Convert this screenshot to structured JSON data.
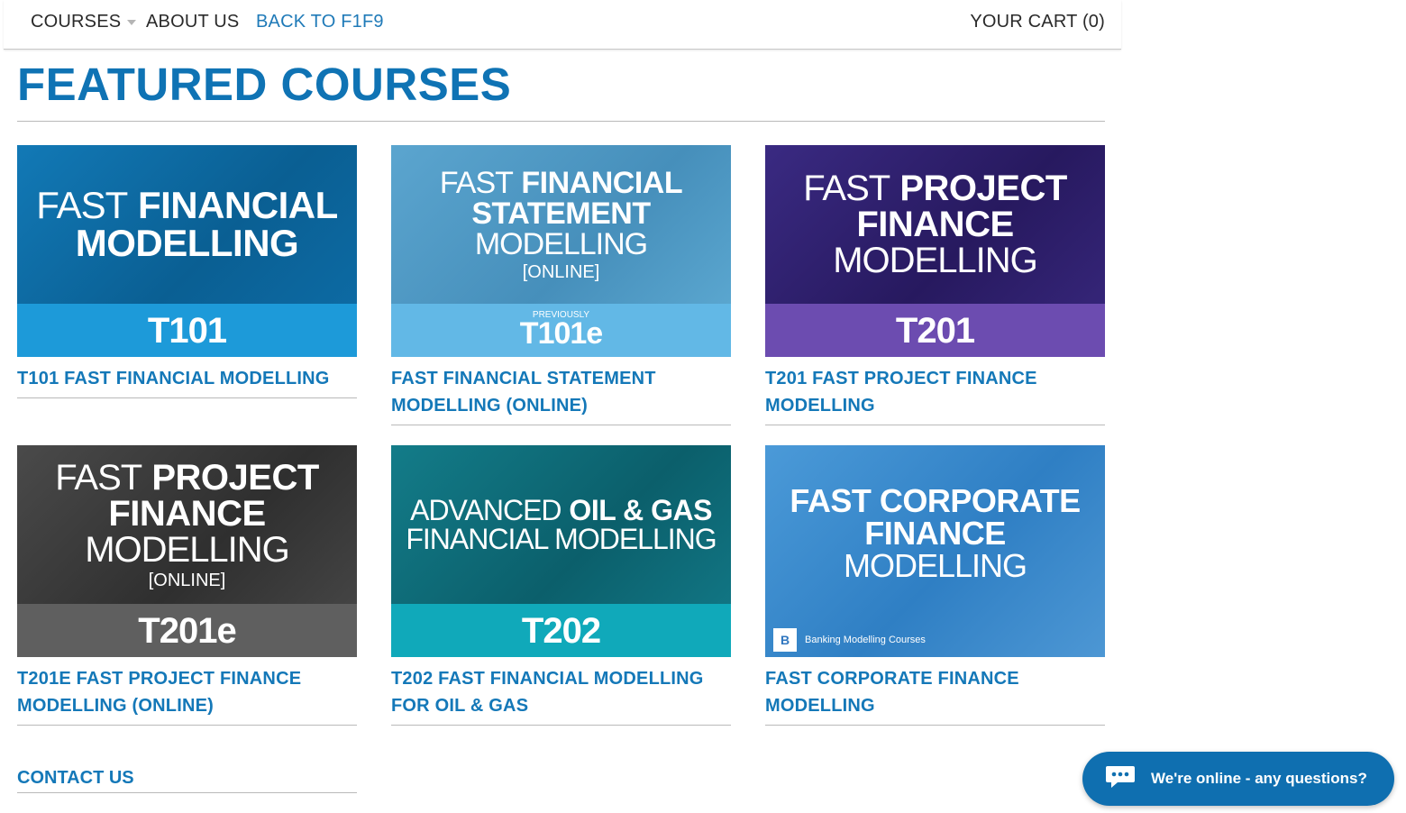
{
  "nav": {
    "courses": "COURSES",
    "about": "ABOUT US",
    "back": "BACK TO F1F9",
    "cart": "YOUR CART (0)"
  },
  "page": {
    "title": "FEATURED COURSES"
  },
  "courses": [
    {
      "image": {
        "line1_light": "FAST",
        "line1_bold": "FINANCIAL",
        "line2": "MODELLING",
        "code": "T101"
      },
      "title": "T101 FAST FINANCIAL MODELLING"
    },
    {
      "image": {
        "line1_light": "FAST",
        "line1_bold": "FINANCIAL",
        "line2": "STATEMENT",
        "line3": "MODELLING",
        "line4": "[ONLINE]",
        "previously": "PREVIOUSLY",
        "code": "T101e"
      },
      "title": "FAST FINANCIAL STATEMENT MODELLING (ONLINE)"
    },
    {
      "image": {
        "line1_light": "FAST",
        "line1_bold": "PROJECT",
        "line2": "FINANCE",
        "line3": "MODELLING",
        "code": "T201"
      },
      "title": "T201 FAST PROJECT FINANCE MODELLING"
    },
    {
      "image": {
        "line1_light": "FAST",
        "line1_bold": "PROJECT",
        "line2": "FINANCE",
        "line3": "MODELLING",
        "line4": "[ONLINE]",
        "code": "T201e"
      },
      "title": "T201E FAST PROJECT FINANCE MODELLING (ONLINE)"
    },
    {
      "image": {
        "line1_light": "ADVANCED",
        "line1_bold": "OIL & GAS",
        "line2": "FINANCIAL MODELLING",
        "code": "T202"
      },
      "title": "T202 FAST FINANCIAL MODELLING FOR OIL & GAS"
    },
    {
      "image": {
        "line1": "FAST CORPORATE",
        "line2": "FINANCE",
        "line3": "MODELLING",
        "logo_letter": "B",
        "logo_text": "Banking Modelling Courses"
      },
      "title": "FAST CORPORATE FINANCE MODELLING"
    }
  ],
  "contact": {
    "title": "CONTACT US"
  },
  "chat": {
    "label": "We're online - any questions?",
    "icon": "chat-bubble-icon"
  },
  "colors": {
    "brand": "#0f73b4",
    "link": "#1478b8",
    "chat": "#0f6fb0"
  }
}
